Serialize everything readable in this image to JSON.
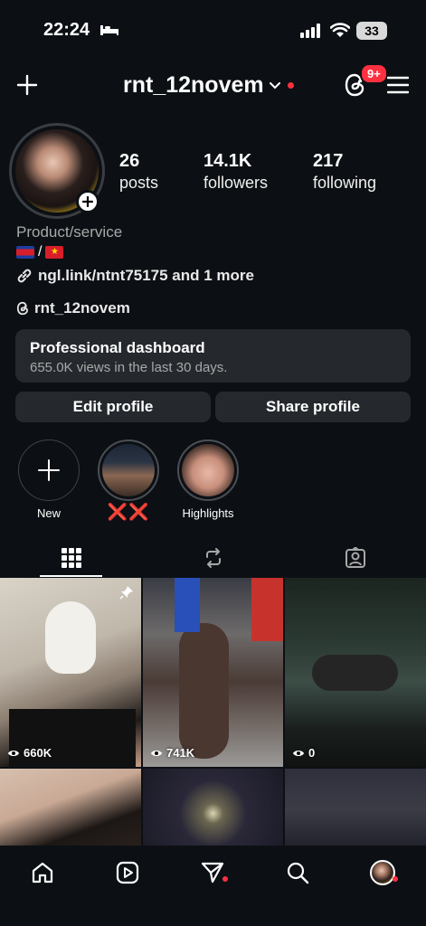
{
  "status_bar": {
    "time": "22:24",
    "battery": "33"
  },
  "header": {
    "username": "rnt_12novem",
    "notification_count": "9+"
  },
  "profile": {
    "stats": [
      {
        "value": "26",
        "label": "posts"
      },
      {
        "value": "14.1K",
        "label": "followers"
      },
      {
        "value": "217",
        "label": "following"
      }
    ],
    "category": "Product/service",
    "flags_separator": "/",
    "link": "ngl.link/ntnt75175 and 1 more",
    "threads_handle": "rnt_12novem"
  },
  "dashboard": {
    "title": "Professional dashboard",
    "subtitle": "655.0K views in the last 30 days."
  },
  "buttons": {
    "edit": "Edit profile",
    "share": "Share profile"
  },
  "highlights": [
    {
      "label": "New"
    },
    {
      "label": "❌❌"
    },
    {
      "label": "Highlights"
    }
  ],
  "grid": {
    "posts": [
      {
        "views": "660K",
        "pinned": true
      },
      {
        "views": "741K",
        "pinned": false
      },
      {
        "views": "0",
        "pinned": false
      },
      {
        "views": "",
        "pinned": false
      },
      {
        "views": "",
        "pinned": false
      },
      {
        "views": "",
        "pinned": false
      }
    ]
  },
  "icons": {
    "header": [
      "plus-icon",
      "chevron-down-icon",
      "threads-icon",
      "hamburger-menu-icon"
    ],
    "tabs": [
      "grid-icon",
      "reels-repost-icon",
      "tagged-icon"
    ],
    "nav": [
      "home-icon",
      "reels-icon",
      "direct-icon",
      "search-icon",
      "profile-avatar"
    ]
  },
  "colors": {
    "background": "#0c1014",
    "surface": "#25292e",
    "badge": "#ff3040",
    "secondary_text": "#a8a8a8"
  }
}
